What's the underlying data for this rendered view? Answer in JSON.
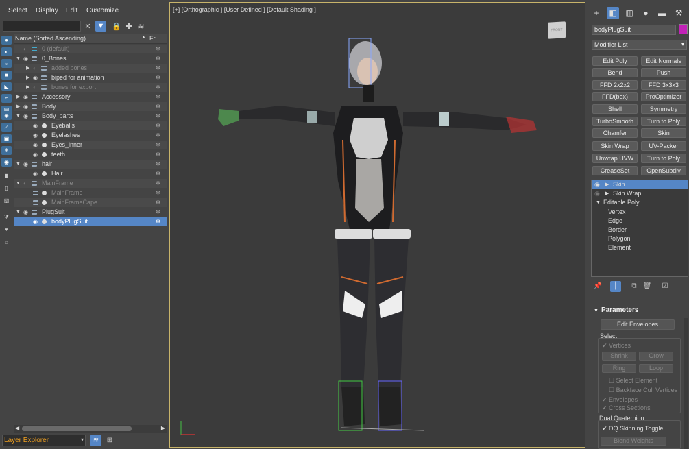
{
  "menu": [
    "Select",
    "Display",
    "Edit",
    "Customize"
  ],
  "explorer": {
    "column_name": "Name (Sorted Ascending)",
    "column_sort_arrow": "▲",
    "column_fr": "Fr...",
    "freeze_glyph": "❄",
    "rows": [
      {
        "label": "0 (default)",
        "dim": true
      },
      {
        "label": "0_Bones"
      },
      {
        "label": "added bones",
        "dim": true
      },
      {
        "label": "biped for animation"
      },
      {
        "label": "bones for export",
        "dim": true
      },
      {
        "label": "Accessory"
      },
      {
        "label": "Body"
      },
      {
        "label": "Body_parts"
      },
      {
        "label": "Eyeballs"
      },
      {
        "label": "Eyelashes"
      },
      {
        "label": "Eyes_inner"
      },
      {
        "label": "teeth"
      },
      {
        "label": "hair"
      },
      {
        "label": "Hair"
      },
      {
        "label": "MainFrame",
        "dim": true
      },
      {
        "label": "MainFrame",
        "dim": true
      },
      {
        "label": "MainFrameCape",
        "dim": true
      },
      {
        "label": "PlugSuit"
      },
      {
        "label": "bodyPlugSuit"
      }
    ],
    "explorer_type": "Layer Explorer"
  },
  "viewport": {
    "label": "[+] [Orthographic ] [User Defined ] [Default Shading ]",
    "viewcube_text": "FRONT"
  },
  "right": {
    "object_name": "bodyPlugSuit",
    "object_color": "#c322b8",
    "modifier_list": "Modifier List",
    "modifier_buttons": [
      "Edit Poly",
      "Edit Normals",
      "Bend",
      "Push",
      "FFD 2x2x2",
      "FFD 3x3x3",
      "FFD(box)",
      "ProOptimizer",
      "Shell",
      "Symmetry",
      "TurboSmooth",
      "Turn to Poly",
      "Chamfer",
      "Skin",
      "Skin Wrap",
      "UV-Packer",
      "Unwrap UVW",
      "Turn to Poly",
      "CreaseSet",
      "OpenSubdiv"
    ],
    "stack": [
      "Skin",
      "Skin Wrap",
      "Editable Poly",
      "Vertex",
      "Edge",
      "Border",
      "Polygon",
      "Element"
    ],
    "params": {
      "title": "Parameters",
      "edit_envelopes": "Edit Envelopes",
      "select": "Select",
      "vertices": "Vertices",
      "shrink": "Shrink",
      "grow": "Grow",
      "ring": "Ring",
      "loop": "Loop",
      "select_element": "Select Element",
      "backface": "Backface Cull Vertices",
      "envelopes": "Envelopes",
      "cross_sections": "Cross Sections",
      "dual_quat": "Dual Quaternion",
      "dq_toggle": "DQ Skinning Toggle",
      "blend_weights": "Blend Weights"
    }
  }
}
